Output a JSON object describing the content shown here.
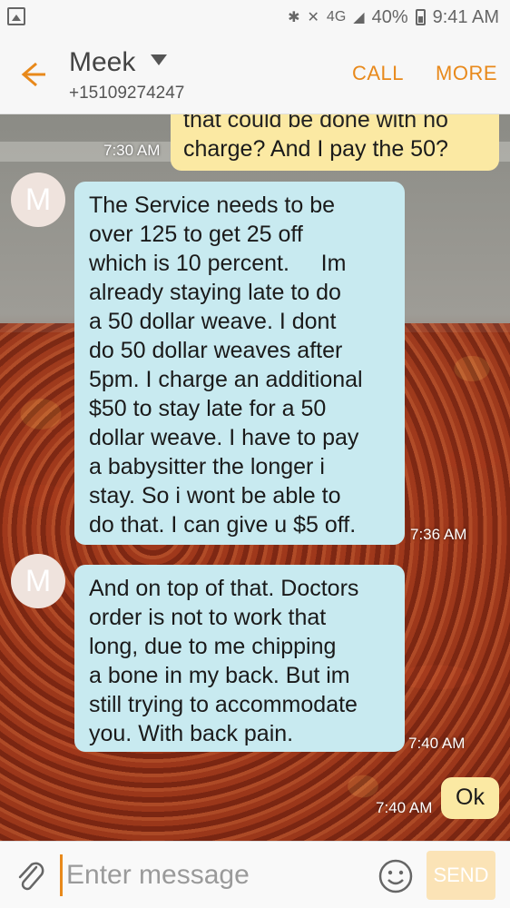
{
  "status_bar": {
    "signal_label": "4G",
    "battery": "40%",
    "time": "9:41 AM"
  },
  "header": {
    "contact_name": "Meek",
    "contact_number": "+15109274247",
    "call_label": "CALL",
    "more_label": "MORE"
  },
  "conversation": {
    "messages": [
      {
        "direction": "outgoing",
        "text_partial_top": "that could be done with no",
        "text": "charge? And I pay the 50?",
        "time": "7:30 AM"
      },
      {
        "direction": "incoming",
        "avatar_letter": "M",
        "text": "The Service needs to be\nover 125 to get 25 off\nwhich is 10 percent.     Im\nalready staying late to do\na 50 dollar weave. I dont\ndo 50 dollar weaves after\n5pm. I charge an additional\n$50 to stay late for a 50\ndollar weave. I have to pay\na babysitter the longer i\nstay. So i wont be able to\ndo that. I can give u $5 off.",
        "time": "7:36 AM"
      },
      {
        "direction": "incoming",
        "avatar_letter": "M",
        "text": "And on top of that. Doctors\norder is not to work that\nlong, due to me chipping\na bone in my back. But im\nstill trying to accommodate\nyou. With back pain.",
        "time": "7:40 AM"
      },
      {
        "direction": "outgoing",
        "text": "Ok",
        "time": "7:40 AM"
      }
    ]
  },
  "input_bar": {
    "placeholder": "Enter message",
    "send_label": "SEND"
  },
  "colors": {
    "accent": "#e8891b",
    "incoming_bubble": "#c8eaf0",
    "outgoing_bubble": "#fbe9a3"
  }
}
